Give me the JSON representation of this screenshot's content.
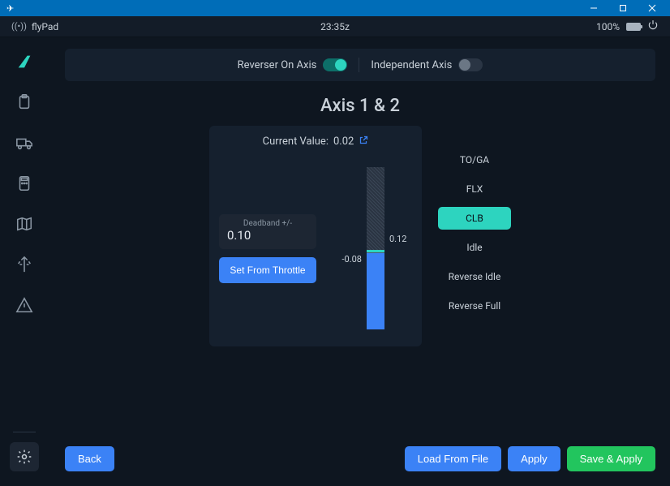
{
  "titlebar": {
    "icon": "✈"
  },
  "header": {
    "app_name": "flyPad",
    "time": "23:35z",
    "battery_text": "100%"
  },
  "toggles": {
    "reverser_label": "Reverser On Axis",
    "independent_label": "Independent Axis"
  },
  "page": {
    "title": "Axis 1 & 2",
    "current_value_label": "Current Value:",
    "current_value": "0.02"
  },
  "deadband": {
    "label": "Deadband +/-",
    "value": "0.10"
  },
  "gauge": {
    "upper_tick": "0.12",
    "lower_tick": "-0.08"
  },
  "buttons": {
    "set_throttle": "Set From Throttle",
    "back": "Back",
    "load": "Load From File",
    "apply": "Apply",
    "save_apply": "Save & Apply"
  },
  "detents": [
    {
      "label": "TO/GA",
      "active": false
    },
    {
      "label": "FLX",
      "active": false
    },
    {
      "label": "CLB",
      "active": true
    },
    {
      "label": "Idle",
      "active": false
    },
    {
      "label": "Reverse Idle",
      "active": false
    },
    {
      "label": "Reverse Full",
      "active": false
    }
  ]
}
